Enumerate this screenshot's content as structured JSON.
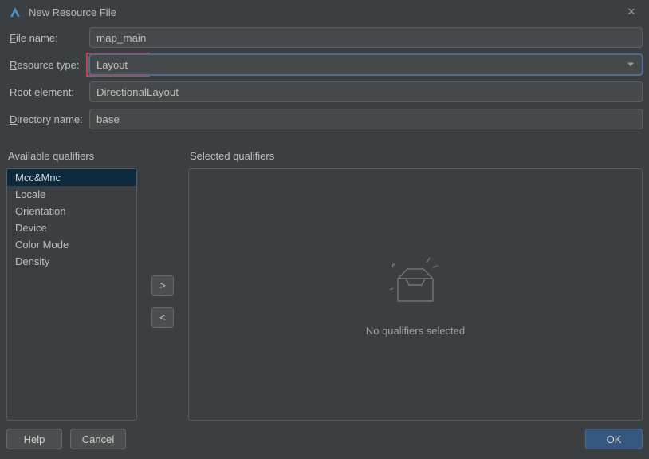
{
  "titlebar": {
    "title": "New Resource File"
  },
  "form": {
    "file_name": {
      "label_pre": "F",
      "label_post": "ile name:",
      "value": "map_main"
    },
    "resource_type": {
      "label_pre": "R",
      "label_post": "esource type:",
      "value": "Layout"
    },
    "root_element": {
      "label": "Root ",
      "label_u": "e",
      "label_post": "lement:",
      "value": "DirectionalLayout"
    },
    "directory_name": {
      "label_pre": "D",
      "label_post": "irectory name:",
      "value": "base"
    }
  },
  "qualifiers": {
    "available_header": "Available qualifiers",
    "selected_header": "Selected qualifiers",
    "items": [
      "Mcc&Mnc",
      "Locale",
      "Orientation",
      "Device",
      "Color Mode",
      "Density"
    ],
    "empty_text": "No qualifiers selected"
  },
  "buttons": {
    "add": ">",
    "remove": "<",
    "help": "Help",
    "cancel": "Cancel",
    "ok": "OK"
  }
}
